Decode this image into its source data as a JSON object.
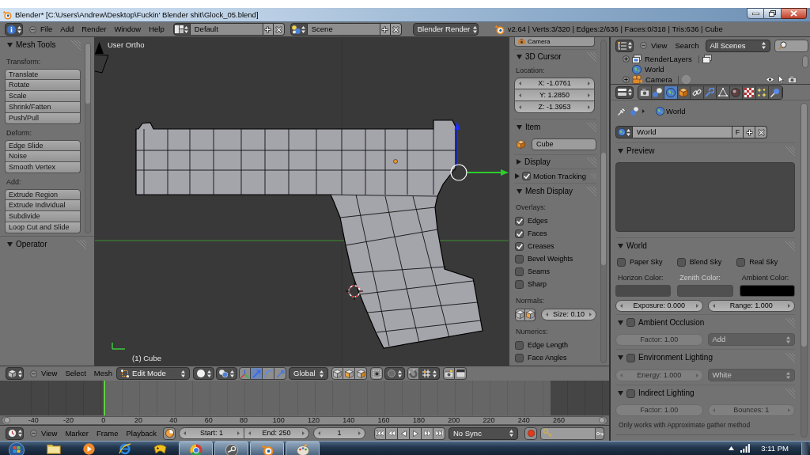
{
  "window": {
    "title": "Blender* [C:\\Users\\Andrew\\Desktop\\Fuckin' Blender shit\\Glock_05.blend]"
  },
  "info_header": {
    "menus": [
      "File",
      "Add",
      "Render",
      "Window",
      "Help"
    ],
    "screen_layout": "Default",
    "scene": "Scene",
    "render_engine": "Blender Render",
    "stats": "v2.64 | Verts:3/320 | Edges:2/636 | Faces:0/318 | Tris:636 | Cube"
  },
  "tool_shelf": {
    "mesh_tools": {
      "title": "Mesh Tools",
      "expanded": true,
      "groups": [
        {
          "label": "Transform:",
          "buttons": [
            "Translate",
            "Rotate",
            "Scale",
            "Shrink/Fatten",
            "Push/Pull"
          ]
        },
        {
          "label": "Deform:",
          "buttons": [
            "Edge Slide",
            "Noise",
            "Smooth Vertex"
          ]
        },
        {
          "label": "Add:",
          "buttons": [
            "Extrude Region",
            "Extrude Individual",
            "Subdivide",
            "Loop Cut and Slide"
          ]
        }
      ]
    },
    "operator": {
      "title": "Operator",
      "expanded": true
    }
  },
  "viewport": {
    "view_name": "User Ortho",
    "object_label": "(1) Cube"
  },
  "n_panel": {
    "clipped_field": "Camera",
    "cursor": {
      "title": "3D Cursor",
      "expanded": true,
      "location_label": "Location:",
      "fields": [
        "X: -1.0761",
        "Y: 1.2850",
        "Z: -1.3953"
      ]
    },
    "item": {
      "title": "Item",
      "expanded": true,
      "name": "Cube"
    },
    "display": {
      "title": "Display",
      "expanded": false
    },
    "motion_tracking": {
      "title": "Motion Tracking",
      "expanded": false,
      "checked": true
    },
    "mesh_display": {
      "title": "Mesh Display",
      "expanded": true,
      "overlays_label": "Overlays:",
      "overlays": [
        {
          "label": "Edges",
          "checked": true
        },
        {
          "label": "Faces",
          "checked": true
        },
        {
          "label": "Creases",
          "checked": true
        },
        {
          "label": "Bevel Weights",
          "checked": false
        },
        {
          "label": "Seams",
          "checked": false
        },
        {
          "label": "Sharp",
          "checked": false
        }
      ],
      "normals_label": "Normals:",
      "normals_size": "Size: 0.10",
      "numerics_label": "Numerics:",
      "numerics": [
        {
          "label": "Edge Length",
          "checked": false
        },
        {
          "label": "Face Angles",
          "checked": false
        }
      ]
    }
  },
  "view3d_header": {
    "menus": [
      "View",
      "Select",
      "Mesh"
    ],
    "mode": "Edit Mode",
    "orientation": "Global"
  },
  "timeline": {
    "ruler": [
      "-40",
      "-20",
      "0",
      "20",
      "40",
      "60",
      "80",
      "100",
      "120",
      "140",
      "160",
      "180",
      "200",
      "220",
      "240",
      "260"
    ],
    "menus": [
      "View",
      "Marker",
      "Frame",
      "Playback"
    ],
    "start": "Start: 1",
    "end": "End: 250",
    "current_frame": "1",
    "sync": "No Sync"
  },
  "outliner": {
    "menus": [
      "View",
      "Search"
    ],
    "filter": "All Scenes",
    "rows": [
      {
        "kind": "render_layers",
        "label": "RenderLayers",
        "expandable": true
      },
      {
        "kind": "world",
        "label": "World",
        "expandable": false
      },
      {
        "kind": "camera",
        "label": "Camera",
        "expandable": true
      }
    ]
  },
  "properties": {
    "tabs": [
      {
        "kind": "render",
        "selected": false
      },
      {
        "kind": "scene",
        "selected": false
      },
      {
        "kind": "world",
        "selected": true
      },
      {
        "kind": "object",
        "selected": false
      },
      {
        "kind": "constraints",
        "selected": false
      },
      {
        "kind": "modifiers",
        "selected": false
      },
      {
        "kind": "data",
        "selected": false
      },
      {
        "kind": "material",
        "selected": false
      },
      {
        "kind": "texture",
        "selected": false
      },
      {
        "kind": "particles",
        "selected": false
      },
      {
        "kind": "physics",
        "selected": false
      }
    ],
    "breadcrumb": "World",
    "datablock": {
      "name": "World",
      "fake_user": "F"
    },
    "preview": {
      "title": "Preview",
      "expanded": true
    },
    "world": {
      "title": "World",
      "expanded": true,
      "sky_options": [
        {
          "label": "Paper Sky",
          "checked": false
        },
        {
          "label": "Blend Sky",
          "checked": false
        },
        {
          "label": "Real Sky",
          "checked": false
        }
      ],
      "colors": [
        {
          "label": "Horizon Color:",
          "color": "#4a4a4a",
          "disabled": false
        },
        {
          "label": "Zenith Color:",
          "color": "#505050",
          "disabled": true
        },
        {
          "label": "Ambient Color:",
          "color": "#000000",
          "disabled": false
        }
      ],
      "exposure": "Exposure: 0.000",
      "range": "Range: 1.000"
    },
    "ambient_occlusion": {
      "title": "Ambient Occlusion",
      "expanded": true,
      "checked": false,
      "factor": "Factor: 1.00",
      "blend": "Add"
    },
    "environment_lighting": {
      "title": "Environment Lighting",
      "expanded": true,
      "checked": false,
      "energy": "Energy: 1.000",
      "color_source": "White"
    },
    "indirect_lighting": {
      "title": "Indirect Lighting",
      "expanded": true,
      "checked": false,
      "factor": "Factor: 1.00",
      "bounces": "Bounces: 1",
      "note": "Only works with Approximate gather method"
    }
  },
  "taskbar": {
    "apps": [
      {
        "kind": "explorer",
        "running": false
      },
      {
        "kind": "media_player",
        "running": false
      },
      {
        "kind": "internet_explorer",
        "running": false
      },
      {
        "kind": "games",
        "running": false
      },
      {
        "kind": "chrome",
        "running": true
      },
      {
        "kind": "steam",
        "running": true
      },
      {
        "kind": "blender",
        "running": true
      },
      {
        "kind": "paint",
        "running": true
      }
    ],
    "clock": "3:11 PM"
  }
}
